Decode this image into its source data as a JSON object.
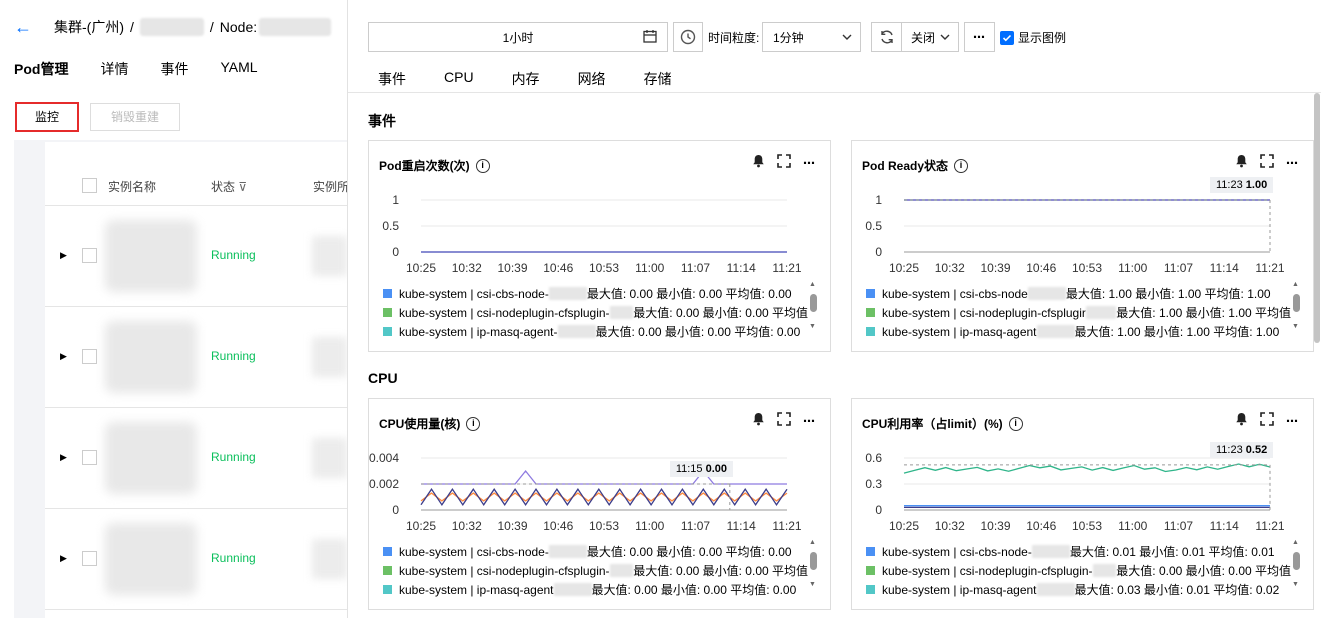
{
  "breadcrumb": {
    "cluster": "集群-(广州)",
    "sep": "/",
    "node_label": "Node:"
  },
  "left_tabs": [
    "Pod管理",
    "详情",
    "事件",
    "YAML"
  ],
  "buttons": {
    "monitor": "监控",
    "rebuild": "销毁重建"
  },
  "table": {
    "headers": [
      "实例名称",
      "状态",
      "实例所"
    ],
    "rows": [
      {
        "status": "Running"
      },
      {
        "status": "Running"
      },
      {
        "status": "Running"
      },
      {
        "status": "Running"
      }
    ]
  },
  "toolbar": {
    "time_range": "1小时",
    "granularity_label": "时间粒度:",
    "granularity": "1分钟",
    "close": "关闭",
    "more": "⋯",
    "show_legend": "显示图例"
  },
  "metric_tabs": [
    "事件",
    "CPU",
    "内存",
    "网络",
    "存储"
  ],
  "sections": {
    "events": "事件",
    "cpu": "CPU"
  },
  "colors": {
    "accent": "#006eff",
    "running": "#0abf5b",
    "highlight": "#e52b2b"
  },
  "cards": [
    {
      "title": "Pod重启次数(次)",
      "tooltip": null,
      "legend": [
        {
          "color": "#4a90f4",
          "text": "kube-system | csi-cbs-node-",
          "stats": "最大值: 0.00 最小值: 0.00 平均值: 0.00"
        },
        {
          "color": "#6cc065",
          "text": "kube-system | csi-nodeplugin-cfsplugin-",
          "stats": "最大值: 0.00 最小值: 0.00 平均值"
        },
        {
          "color": "#52c7c7",
          "text": "kube-system | ip-masq-agent-",
          "stats": "最大值: 0.00 最小值: 0.00 平均值: 0.00"
        }
      ]
    },
    {
      "title": "Pod Ready状态",
      "tooltip": {
        "time": "11:23",
        "value": "1.00"
      },
      "legend": [
        {
          "color": "#4a90f4",
          "text": "kube-system | csi-cbs-node",
          "stats": "最大值: 1.00 最小值: 1.00 平均值: 1.00"
        },
        {
          "color": "#6cc065",
          "text": "kube-system | csi-nodeplugin-cfsplugir",
          "stats": "最大值: 1.00 最小值: 1.00 平均值"
        },
        {
          "color": "#52c7c7",
          "text": "kube-system | ip-masq-agent",
          "stats": "最大值: 1.00 最小值: 1.00 平均值: 1.00"
        }
      ]
    },
    {
      "title": "CPU使用量(核)",
      "tooltip": {
        "time": "11:15",
        "value": "0.00"
      },
      "legend": [
        {
          "color": "#4a90f4",
          "text": "kube-system | csi-cbs-node-",
          "stats": "最大值: 0.00 最小值: 0.00 平均值: 0.00"
        },
        {
          "color": "#6cc065",
          "text": "kube-system | csi-nodeplugin-cfsplugin-",
          "stats": "最大值: 0.00 最小值: 0.00 平均值"
        },
        {
          "color": "#52c7c7",
          "text": "kube-system | ip-masq-agent",
          "stats": "最大值: 0.00 最小值: 0.00 平均值: 0.00"
        }
      ]
    },
    {
      "title": "CPU利用率（占limit）(%)",
      "tooltip": {
        "time": "11:23",
        "value": "0.52"
      },
      "legend": [
        {
          "color": "#4a90f4",
          "text": "kube-system | csi-cbs-node-",
          "stats": "最大值: 0.01 最小值: 0.01 平均值: 0.01"
        },
        {
          "color": "#6cc065",
          "text": "kube-system | csi-nodeplugin-cfsplugin-",
          "stats": "最大值: 0.00 最小值: 0.00 平均值"
        },
        {
          "color": "#52c7c7",
          "text": "kube-system | ip-masq-agent",
          "stats": "最大值: 0.03 最小值: 0.01 平均值: 0.02"
        }
      ]
    }
  ],
  "chart_data": [
    {
      "type": "line",
      "title": "Pod重启次数(次)",
      "x": [
        "10:25",
        "10:32",
        "10:39",
        "10:46",
        "10:53",
        "11:00",
        "11:07",
        "11:14",
        "11:21"
      ],
      "ylim": [
        0,
        1
      ],
      "yticks": [
        "1",
        "0.5",
        "0"
      ],
      "series": [
        {
          "name": "kube-system | csi-cbs-node-",
          "color": "#4a90f4",
          "values": [
            0,
            0,
            0,
            0,
            0,
            0,
            0,
            0,
            0
          ]
        },
        {
          "name": "kube-system | csi-nodeplugin-cfsplugin-",
          "color": "#6cc065",
          "values": [
            0,
            0,
            0,
            0,
            0,
            0,
            0,
            0,
            0
          ]
        },
        {
          "name": "kube-system | ip-masq-agent-",
          "color": "#52c7c7",
          "values": [
            0,
            0,
            0,
            0,
            0,
            0,
            0,
            0,
            0
          ]
        },
        {
          "name": "",
          "color": "#7b61d1",
          "values": [
            0,
            0,
            0,
            0,
            0,
            0,
            0,
            0,
            0
          ]
        }
      ]
    },
    {
      "type": "line",
      "title": "Pod Ready状态",
      "x": [
        "10:25",
        "10:32",
        "10:39",
        "10:46",
        "10:53",
        "11:00",
        "11:07",
        "11:14",
        "11:21"
      ],
      "ylim": [
        0,
        1
      ],
      "yticks": [
        "1",
        "0.5",
        "0"
      ],
      "series": [
        {
          "name": "kube-system | csi-cbs-node",
          "color": "#4a90f4",
          "values": [
            1,
            1,
            1,
            1,
            1,
            1,
            1,
            1,
            1
          ]
        },
        {
          "name": "kube-system | csi-nodeplugin-cfsplugir",
          "color": "#6cc065",
          "values": [
            1,
            1,
            1,
            1,
            1,
            1,
            1,
            1,
            1
          ]
        },
        {
          "name": "kube-system | ip-masq-agent",
          "color": "#7b61d1",
          "values": [
            1,
            1,
            1,
            1,
            1,
            1,
            1,
            1,
            1
          ]
        }
      ]
    },
    {
      "type": "line",
      "title": "CPU使用量(核)",
      "x": [
        "10:25",
        "10:32",
        "10:39",
        "10:46",
        "10:53",
        "11:00",
        "11:07",
        "11:14",
        "11:21"
      ],
      "ylim": [
        0,
        0.004
      ],
      "yticks": [
        "0.004",
        "0.002",
        "0"
      ],
      "series": [
        {
          "name": "",
          "color": "#8e7ae0",
          "values": [
            0.002,
            0.002,
            0.002,
            0.002,
            0.002,
            0.002,
            0.002,
            0.002,
            0.002
          ]
        },
        {
          "name": "",
          "color": "#ff8a3d",
          "values": [
            0.001,
            0.001,
            0.001,
            0.001,
            0.001,
            0.001,
            0.001,
            0.001,
            0.001
          ]
        },
        {
          "name": "",
          "color": "#3d3d8a",
          "values": [
            0.001,
            0.001,
            0.001,
            0.001,
            0.001,
            0.001,
            0.001,
            0.001,
            0.001
          ]
        }
      ]
    },
    {
      "type": "line",
      "title": "CPU利用率（占limit）(%)",
      "x": [
        "10:25",
        "10:32",
        "10:39",
        "10:46",
        "10:53",
        "11:00",
        "11:07",
        "11:14",
        "11:21"
      ],
      "ylim": [
        0,
        0.6
      ],
      "yticks": [
        "0.6",
        "0.3",
        "0"
      ],
      "series": [
        {
          "name": "",
          "color": "#2fb58a",
          "values": [
            0.45,
            0.48,
            0.46,
            0.5,
            0.47,
            0.49,
            0.46,
            0.5,
            0.52
          ]
        },
        {
          "name": "kube-system | csi-cbs-node-",
          "color": "#4a90f4",
          "values": [
            0.05,
            0.05,
            0.05,
            0.05,
            0.05,
            0.05,
            0.05,
            0.05,
            0.05
          ]
        },
        {
          "name": "",
          "color": "#3d3d8a",
          "values": [
            0.03,
            0.03,
            0.03,
            0.03,
            0.03,
            0.03,
            0.03,
            0.03,
            0.03
          ]
        }
      ]
    }
  ]
}
